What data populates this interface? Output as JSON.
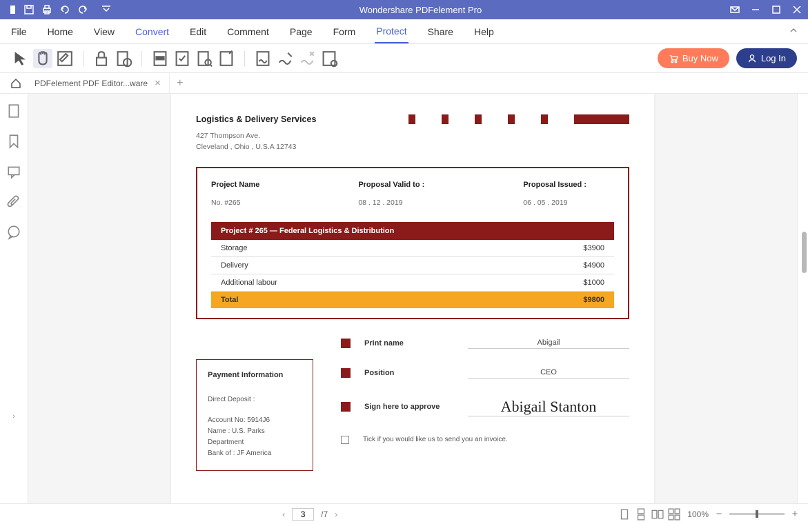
{
  "app": {
    "title": "Wondershare PDFelement Pro"
  },
  "menu": {
    "file": "File",
    "home": "Home",
    "view": "View",
    "convert": "Convert",
    "edit": "Edit",
    "comment": "Comment",
    "page": "Page",
    "form": "Form",
    "protect": "Protect",
    "share": "Share",
    "help": "Help"
  },
  "actions": {
    "buy": "Buy Now",
    "login": "Log In"
  },
  "tabs": {
    "doc1": "PDFelement  PDF Editor...ware"
  },
  "doc": {
    "company": "Logistics & Delivery Services",
    "addr1": "427 Thompson Ave.",
    "addr2": "Cleveland , Ohio , U.S.A 12743",
    "projectNameLabel": "Project Name",
    "projectNameVal": "No. #265",
    "validLabel": "Proposal Valid to :",
    "validVal": "08 . 12 . 2019",
    "issuedLabel": "Proposal Issued :",
    "issuedVal": "06 . 05 . 2019",
    "tableHeader": "Project # 265 — Federal Logistics & Distribution",
    "rows": [
      {
        "label": "Storage",
        "price": "$3900"
      },
      {
        "label": "Delivery",
        "price": "$4900"
      },
      {
        "label": "Additional labour",
        "price": "$1000"
      }
    ],
    "totalLabel": "Total",
    "totalVal": "$9800",
    "paymentTitle": "Payment Information",
    "paymentL1": "Direct Deposit :",
    "paymentL2": "Account No: 5914J6",
    "paymentL3": "Name :  U.S. Parks Department",
    "paymentL4": "Bank of :  JF America",
    "printNameLabel": "Print name",
    "printNameVal": "Abigail",
    "positionLabel": "Position",
    "positionVal": "CEO",
    "signLabel": "Sign here to approve",
    "signVal": "Abigail Stanton",
    "tickLabel": "Tick if you would like us to send you an invoice."
  },
  "status": {
    "pageCur": "3",
    "pageTotal": "/7",
    "zoom": "100%"
  }
}
